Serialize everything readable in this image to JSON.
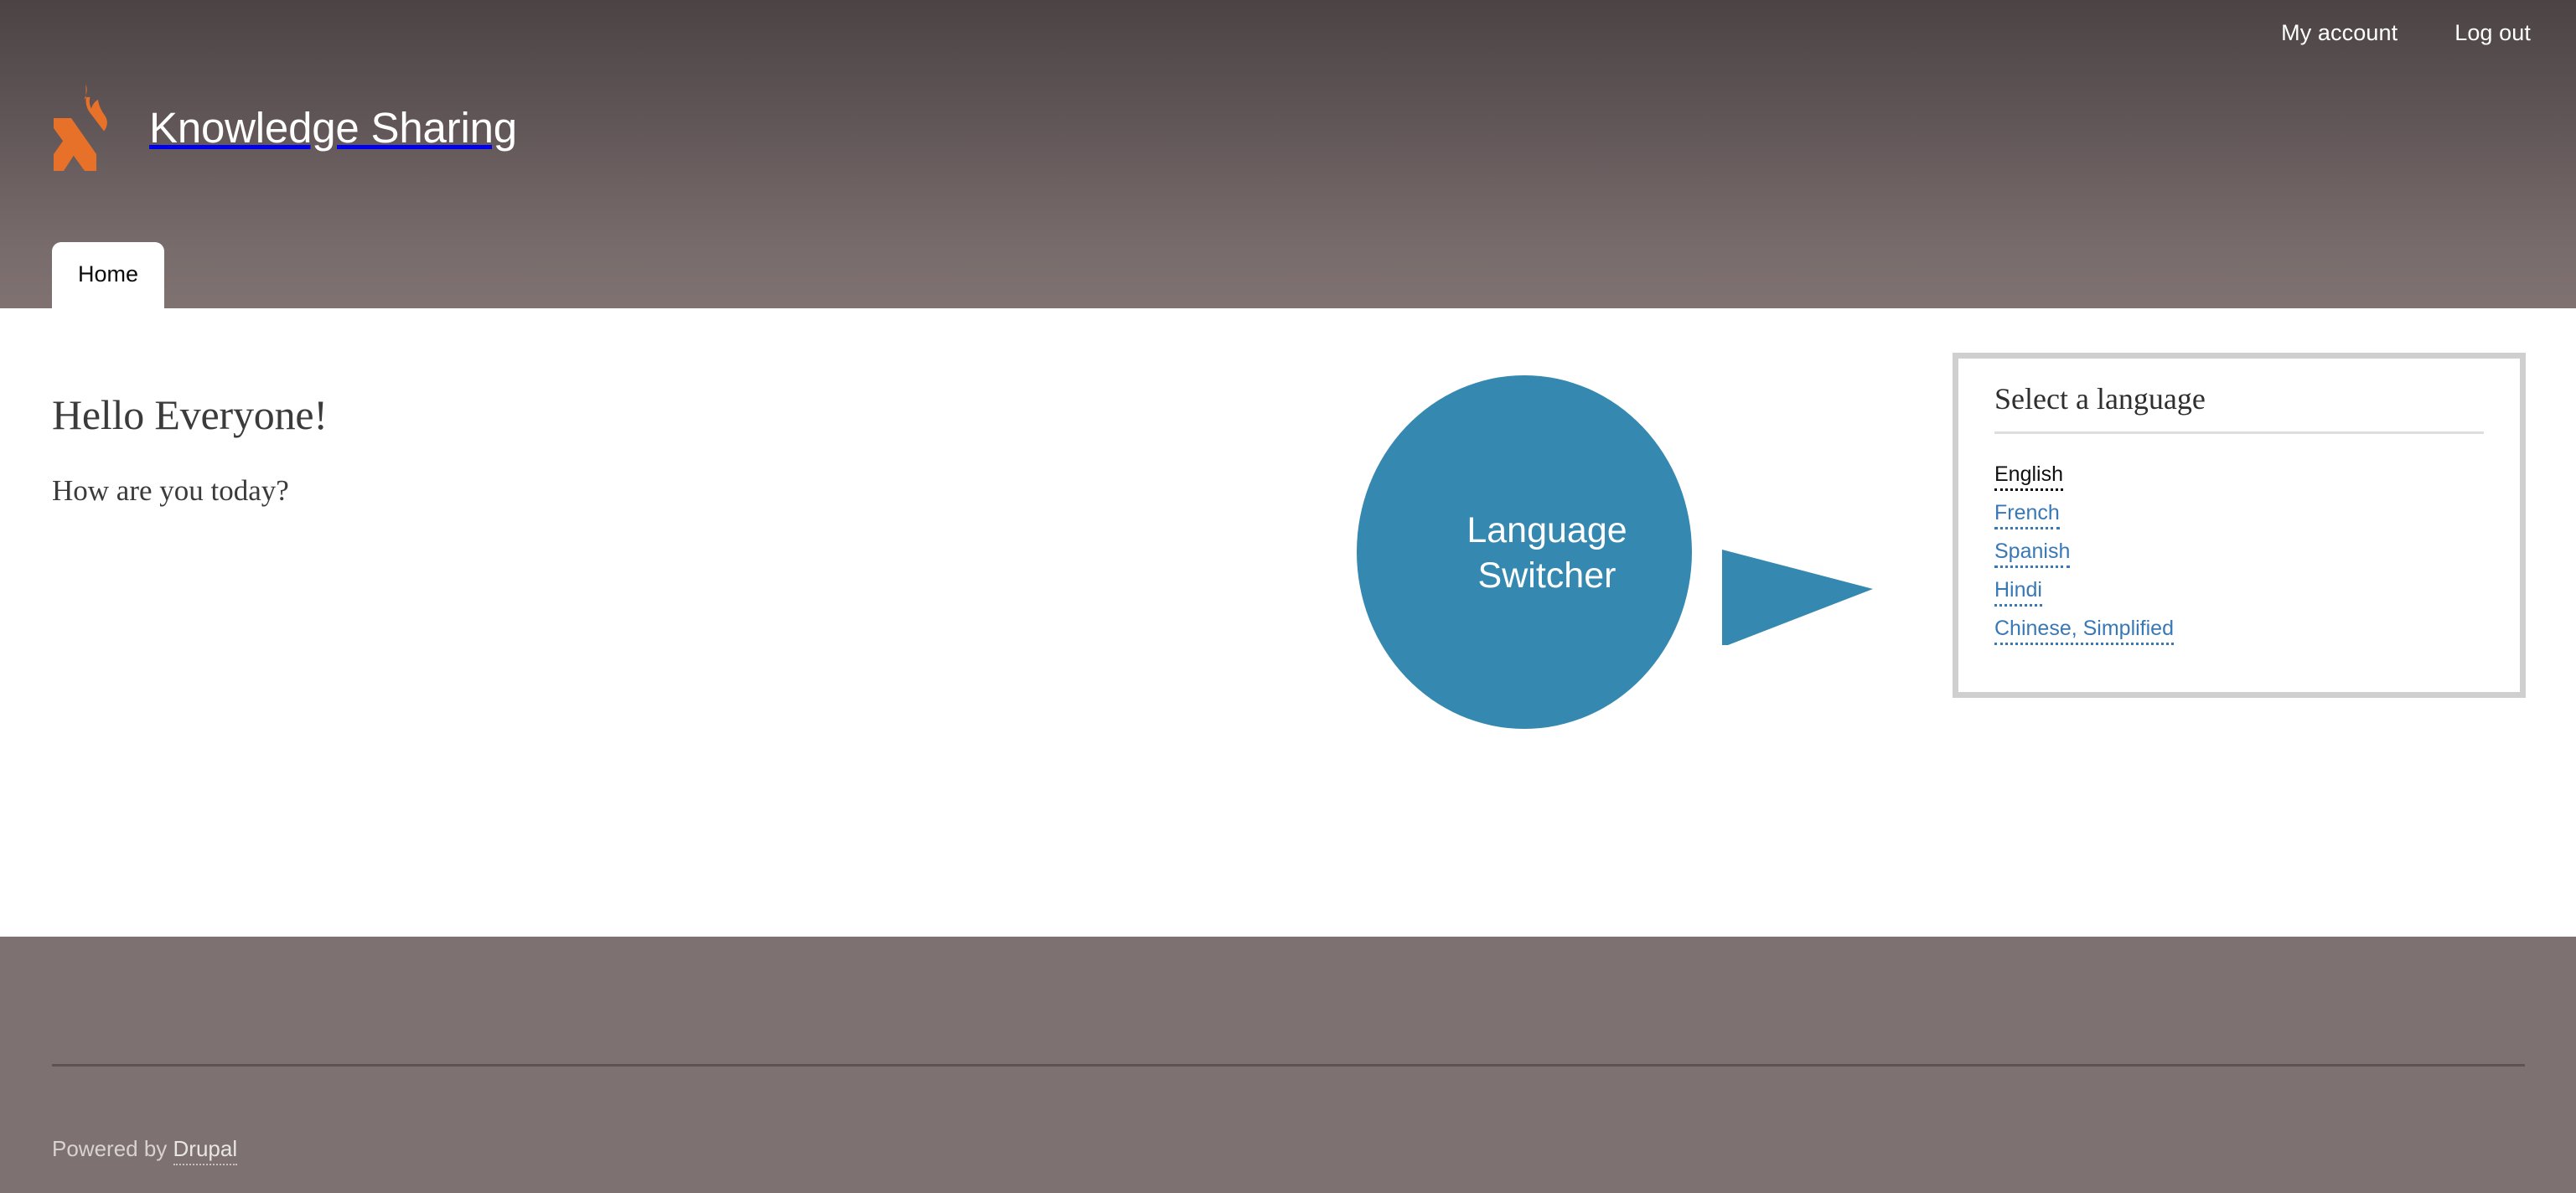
{
  "colors": {
    "header_gradient_top": "#4b4344",
    "header_gradient_bottom": "#7f7271",
    "footer_bg": "#7d7271",
    "logo_orange": "#e8712a",
    "callout_blue": "#3589b0",
    "link_blue": "#3878b5",
    "panel_border": "#cfcfcf"
  },
  "header": {
    "account_nav": [
      {
        "label": "My account",
        "name": "my-account-link"
      },
      {
        "label": "Log out",
        "name": "log-out-link"
      }
    ],
    "logo_icon": "flame-x-logo-icon",
    "site_name": "Knowledge Sharing",
    "tabs": [
      {
        "label": "Home",
        "active": true
      }
    ]
  },
  "main": {
    "page_title": "Hello Everyone!",
    "body_text": "How are you today?",
    "language_block": {
      "title": "Select a language",
      "languages": [
        {
          "label": "English",
          "active": true
        },
        {
          "label": "French",
          "active": false
        },
        {
          "label": "Spanish",
          "active": false
        },
        {
          "label": "Hindi",
          "active": false
        },
        {
          "label": "Chinese, Simplified",
          "active": false
        }
      ]
    },
    "callout": {
      "line1": "Language",
      "line2": "Switcher"
    }
  },
  "footer": {
    "credit_prefix": "Powered by ",
    "credit_link": "Drupal"
  }
}
